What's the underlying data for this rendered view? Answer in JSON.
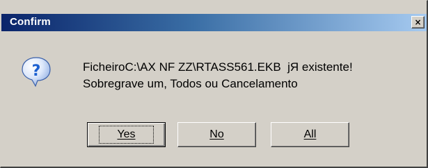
{
  "window": {
    "title": "Confirm",
    "close_symbol": "×"
  },
  "message": {
    "line1": "FicheiroC:\\AX NF ZZ\\RTASS561.EKB  jЯ existente!",
    "line2": "Sobregrave um, Todos ou Cancelamento"
  },
  "icon": {
    "name": "question-icon",
    "glyph": "?"
  },
  "buttons": {
    "yes": "Yes",
    "no": "No",
    "all": "All"
  },
  "colors": {
    "title_gradient_start": "#0a246a",
    "title_gradient_end": "#a6caf0",
    "dialog_face": "#d4d0c8",
    "icon_blue": "#1a5fd0"
  }
}
